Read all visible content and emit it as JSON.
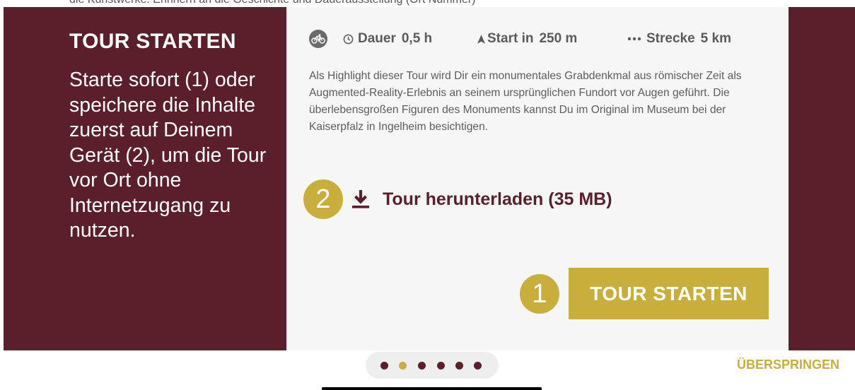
{
  "top_strip": {
    "clipped_text": "die Kunstwerke: Erinnern an die Geschichte und Dauerausstellung (Ort Nummer)"
  },
  "onboarding": {
    "title": "TOUR STARTEN",
    "body": "Starte sofort (1) oder speichere die Inhalte zuerst auf Deinem Gerät (2), um die Tour vor Ort ohne Internetzugang zu nutzen."
  },
  "tour": {
    "mode_icon": "bicycle-icon",
    "meta": {
      "duration_label": "Dauer",
      "duration_value": "0,5 h",
      "start_label": "Start in",
      "start_value": "250 m",
      "distance_label": "Strecke",
      "distance_value": "5 km"
    },
    "description": "Als Highlight dieser Tour wird Dir ein monumentales Grabdenkmal aus rö­mischer Zeit als Augmented-Reality-Erlebnis an seinem ursprünglichen Fun­dort vor Augen geführt. Die überlebensgroßen Figuren des Monuments kannst Du im Original im Museum bei der Kaiserpfalz in Ingelheim besichtigen.",
    "download_label": "Tour herunterladen (35 MB)",
    "start_button_label": "TOUR STARTEN"
  },
  "badges": {
    "download": "2",
    "start": "1"
  },
  "pager": {
    "count": 6,
    "active_index": 1
  },
  "skip_label": "ÜBERSPRINGEN",
  "colors": {
    "brand": "#5a1f2b",
    "accent": "#c8ae3b",
    "card": "#f6f6f6",
    "text_muted": "#5c5c5c"
  }
}
